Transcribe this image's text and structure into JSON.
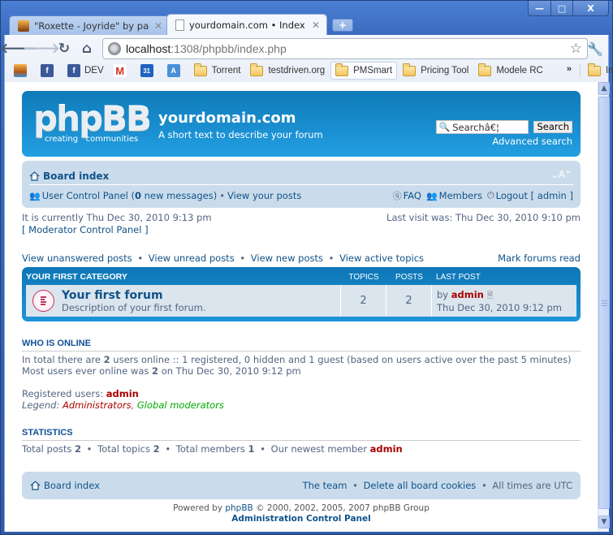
{
  "browser": {
    "tabs": [
      {
        "label": "\"Roxette - Joyride\" by pad…",
        "active": false
      },
      {
        "label": "yourdomain.com • Index p…",
        "active": true
      }
    ],
    "new_tab_label": "+",
    "window_buttons": {
      "minimize": "—",
      "maximize": "□",
      "close": "X"
    },
    "url_host": "localhost",
    "url_rest": ":1308/phpbb/index.php",
    "bookmarks": [
      {
        "label": "",
        "icon": "image-bookmark-icon"
      },
      {
        "label": "",
        "icon": "facebook-icon"
      },
      {
        "label": "DEV",
        "icon": "facebook-icon"
      },
      {
        "label": "",
        "icon": "gmail-icon"
      },
      {
        "label": "",
        "icon": "calendar-icon"
      },
      {
        "label": "",
        "icon": "translate-icon"
      },
      {
        "label": "Torrent",
        "icon": "folder-icon"
      },
      {
        "label": "testdriven.org",
        "icon": "folder-icon"
      },
      {
        "label": "PMSmart",
        "icon": "folder-icon"
      },
      {
        "label": "Pricing Tool",
        "icon": "folder-icon"
      },
      {
        "label": "Modele RC",
        "icon": "folder-icon"
      }
    ],
    "bookmarks_more": "»",
    "other_bookmarks": "Inne zakładki"
  },
  "header": {
    "logo_text": "phpBB",
    "logo_tagline": "creating   communities",
    "site_name": "yourdomain.com",
    "site_description": "A short text to describe your forum",
    "search_value": "Searchâ€¦",
    "search_button": "Search",
    "advanced_search": "Advanced search"
  },
  "navbar": {
    "board_index": "Board index",
    "font_size_control": "⌄A⌃",
    "ucp_label": "User Control Panel (",
    "ucp_count": "0",
    "ucp_suffix": " new messages)",
    "view_your_posts": "View your posts",
    "faq": "FAQ",
    "members": "Members",
    "logout": "Logout [ admin ]"
  },
  "info": {
    "current_time": "It is currently Thu Dec 30, 2010 9:13 pm",
    "last_visit": "Last visit was: Thu Dec 30, 2010 9:10 pm",
    "mcp": "[ Moderator Control Panel ]"
  },
  "links": {
    "unanswered": "View unanswered posts",
    "unread": "View unread posts",
    "new_posts": "View new posts",
    "active": "View active topics",
    "mark_read": "Mark forums read"
  },
  "category": {
    "title": "YOUR FIRST CATEGORY",
    "col_topics": "TOPICS",
    "col_posts": "POSTS",
    "col_last_post": "LAST POST",
    "forums": [
      {
        "title": "Your first forum",
        "description": "Description of your first forum.",
        "topics": "2",
        "posts": "2",
        "last_post_by_prefix": "by ",
        "last_post_author": "admin",
        "last_post_time": "Thu Dec 30, 2010 9:12 pm"
      }
    ]
  },
  "who_is_online": {
    "heading": "WHO IS ONLINE",
    "total_prefix": "In total there are ",
    "total_count": "2",
    "total_suffix": " users online :: 1 registered, 0 hidden and 1 guest (based on users active over the past 5 minutes)",
    "most_prefix": "Most users ever online was ",
    "most_count": "2",
    "most_suffix": " on Thu Dec 30, 2010 9:12 pm",
    "registered_label": "Registered users: ",
    "registered_user": "admin",
    "legend_label": "Legend: ",
    "legend_admins": "Administrators",
    "legend_sep": ", ",
    "legend_mods": "Global moderators"
  },
  "statistics": {
    "heading": "STATISTICS",
    "posts_label": "Total posts ",
    "posts": "2",
    "topics_label": "Total topics ",
    "topics": "2",
    "members_label": "Total members ",
    "members": "1",
    "newest_label": "Our newest member ",
    "newest": "admin"
  },
  "footer": {
    "board_index": "Board index",
    "team": "The team",
    "delete_cookies": "Delete all board cookies",
    "timezone": "All times are UTC",
    "powered_prefix": "Powered by ",
    "powered_link": "phpBB",
    "powered_suffix": " © 2000, 2002, 2005, 2007 phpBB Group",
    "acp": "Administration Control Panel"
  },
  "separator": "•"
}
